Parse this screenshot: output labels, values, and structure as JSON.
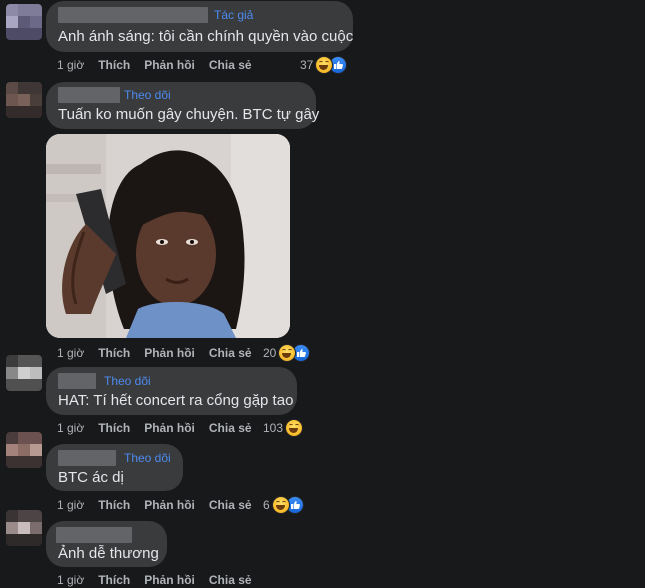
{
  "comments": [
    {
      "tag": "Tác giả",
      "text": "Anh ánh sáng: tôi cần chính quyền vào cuộc",
      "time": "1 giờ",
      "like": "Thích",
      "reply": "Phản hồi",
      "share": "Chia sẻ",
      "reaction_count": "37",
      "reactions": [
        "haha",
        "like"
      ]
    },
    {
      "tag": "Theo dõi",
      "text": "Tuấn ko muốn gây chuyện. BTC tự gây",
      "time": "1 giờ",
      "like": "Thích",
      "reply": "Phản hồi",
      "share": "Chia sẻ",
      "reaction_count": "20",
      "reactions": [
        "haha",
        "like"
      ],
      "attachment": "photo"
    },
    {
      "tag": "Theo dõi",
      "text": "HAT: Tí hết concert ra cổng gặp tao",
      "time": "1 giờ",
      "like": "Thích",
      "reply": "Phản hồi",
      "share": "Chia sẻ",
      "reaction_count": "103",
      "reactions": [
        "haha"
      ]
    },
    {
      "tag": "Theo dõi",
      "text": "BTC ác dị",
      "time": "1 giờ",
      "like": "Thích",
      "reply": "Phản hồi",
      "share": "Chia sẻ",
      "reaction_count": "6",
      "reactions": [
        "haha",
        "like"
      ]
    },
    {
      "tag": "",
      "text": "Ảnh dễ thương",
      "time": "1 giờ",
      "like": "Thích",
      "reply": "Phản hồi",
      "share": "Chia sẻ",
      "reaction_count": "",
      "reactions": []
    }
  ],
  "colors": {
    "background": "#18191a",
    "bubble": "#3a3b3c",
    "tag_link": "#4d8bf0",
    "meta_text": "#b0b3b8"
  }
}
